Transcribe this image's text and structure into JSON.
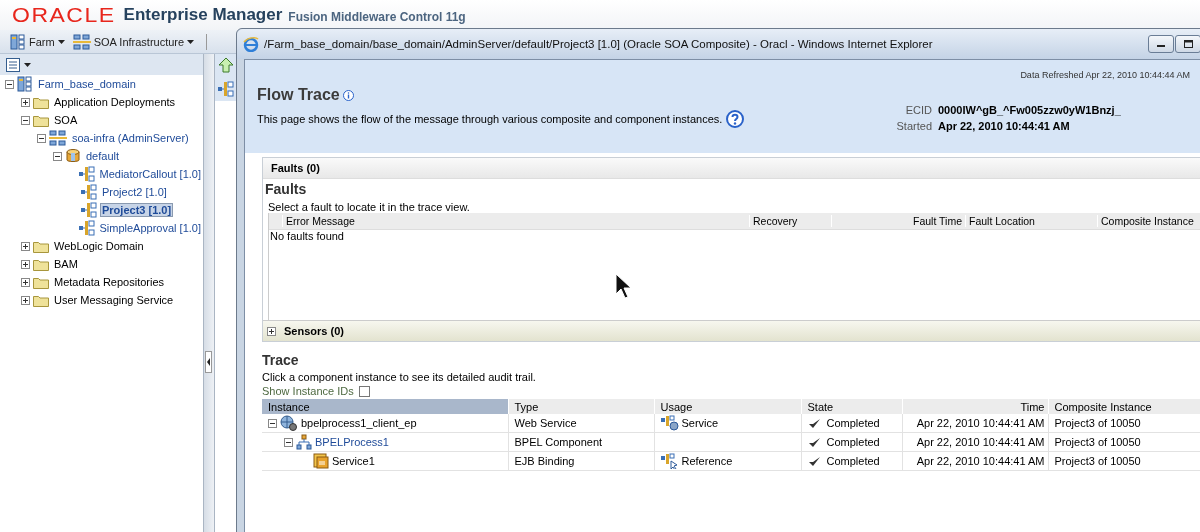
{
  "header": {
    "logo": "ORACLE",
    "product": "Enterprise Manager",
    "subtitle": "Fusion Middleware Control 11g"
  },
  "toolbar": [
    {
      "label": "Farm",
      "kind": "farm"
    },
    {
      "label": "SOA Infrastructure",
      "kind": "soa"
    }
  ],
  "tree": [
    {
      "label": "Farm_base_domain",
      "kind": "farm",
      "expanded": true,
      "selected": false,
      "children": [
        {
          "label": "Application Deployments",
          "kind": "folder",
          "expanded": false,
          "selected": false
        },
        {
          "label": "SOA",
          "kind": "folder",
          "expanded": true,
          "selected": false,
          "children": [
            {
              "label": "soa-infra (AdminServer)",
              "kind": "server",
              "expanded": true,
              "selected": false,
              "children": [
                {
                  "label": "default",
                  "kind": "partition",
                  "expanded": true,
                  "selected": false,
                  "children": [
                    {
                      "label": "MediatorCallout [1.0]",
                      "kind": "composite",
                      "selected": false
                    },
                    {
                      "label": "Project2 [1.0]",
                      "kind": "composite",
                      "selected": false
                    },
                    {
                      "label": "Project3 [1.0]",
                      "kind": "composite",
                      "selected": true
                    },
                    {
                      "label": "SimpleApproval [1.0]",
                      "kind": "composite",
                      "selected": false
                    }
                  ]
                }
              ]
            }
          ]
        },
        {
          "label": "WebLogic Domain",
          "kind": "folder",
          "expanded": false,
          "selected": false
        },
        {
          "label": "BAM",
          "kind": "folder",
          "expanded": false,
          "selected": false
        },
        {
          "label": "Metadata Repositories",
          "kind": "folder",
          "expanded": false,
          "selected": false
        },
        {
          "label": "User Messaging Service",
          "kind": "folder",
          "expanded": false,
          "selected": false
        }
      ]
    }
  ],
  "popup": {
    "title": "/Farm_base_domain/base_domain/AdminServer/default/Project3 [1.0] (Oracle SOA Composite) - Oracl - Windows Internet Explorer",
    "data_refreshed": "Data Refreshed Apr 22, 2010 10:44:44 AM",
    "heading": "Flow Trace",
    "description": "This page shows the flow of the message through various composite and component instances.",
    "ecid_label": "ECID",
    "ecid": "0000IW^gB_^Fw005zzw0yW1Bnzj_",
    "started_label": "Started",
    "started": "Apr 22, 2010 10:44:41 AM",
    "faults": {
      "header": "Faults (0)",
      "title": "Faults",
      "hint": "Select a fault to locate it in the trace view.",
      "columns": [
        "Error Message",
        "Recovery",
        "Fault Time",
        "Fault Location",
        "Composite Instance"
      ],
      "empty": "No faults found"
    },
    "sensors": {
      "header": "Sensors (0)",
      "expanded": false
    },
    "trace": {
      "title": "Trace",
      "hint": "Click a component instance to see its detailed audit trail.",
      "show_ids": {
        "label": "Show Instance IDs",
        "checked": false
      },
      "columns": [
        "Instance",
        "Type",
        "Usage",
        "State",
        "Time",
        "Composite Instance"
      ],
      "rows": [
        {
          "instance": "bpelprocess1_client_ep",
          "kind": "service",
          "expanded": true,
          "type": "Web Service",
          "usage": "Service",
          "state": "Completed",
          "time": "Apr 22, 2010 10:44:41 AM",
          "composite_instance": "Project3 of 10050",
          "children": [
            {
              "instance": "BPELProcess1",
              "kind": "component",
              "expanded": true,
              "type": "BPEL Component",
              "state": "Completed",
              "time": "Apr 22, 2010 10:44:41 AM",
              "composite_instance": "Project3 of 10050",
              "children": [
                {
                  "instance": "Service1",
                  "kind": "reference",
                  "type": "EJB Binding",
                  "usage": "Reference",
                  "state": "Completed",
                  "time": "Apr 22, 2010 10:44:41 AM",
                  "composite_instance": "Project3 of 10050"
                }
              ]
            }
          ]
        }
      ]
    }
  }
}
